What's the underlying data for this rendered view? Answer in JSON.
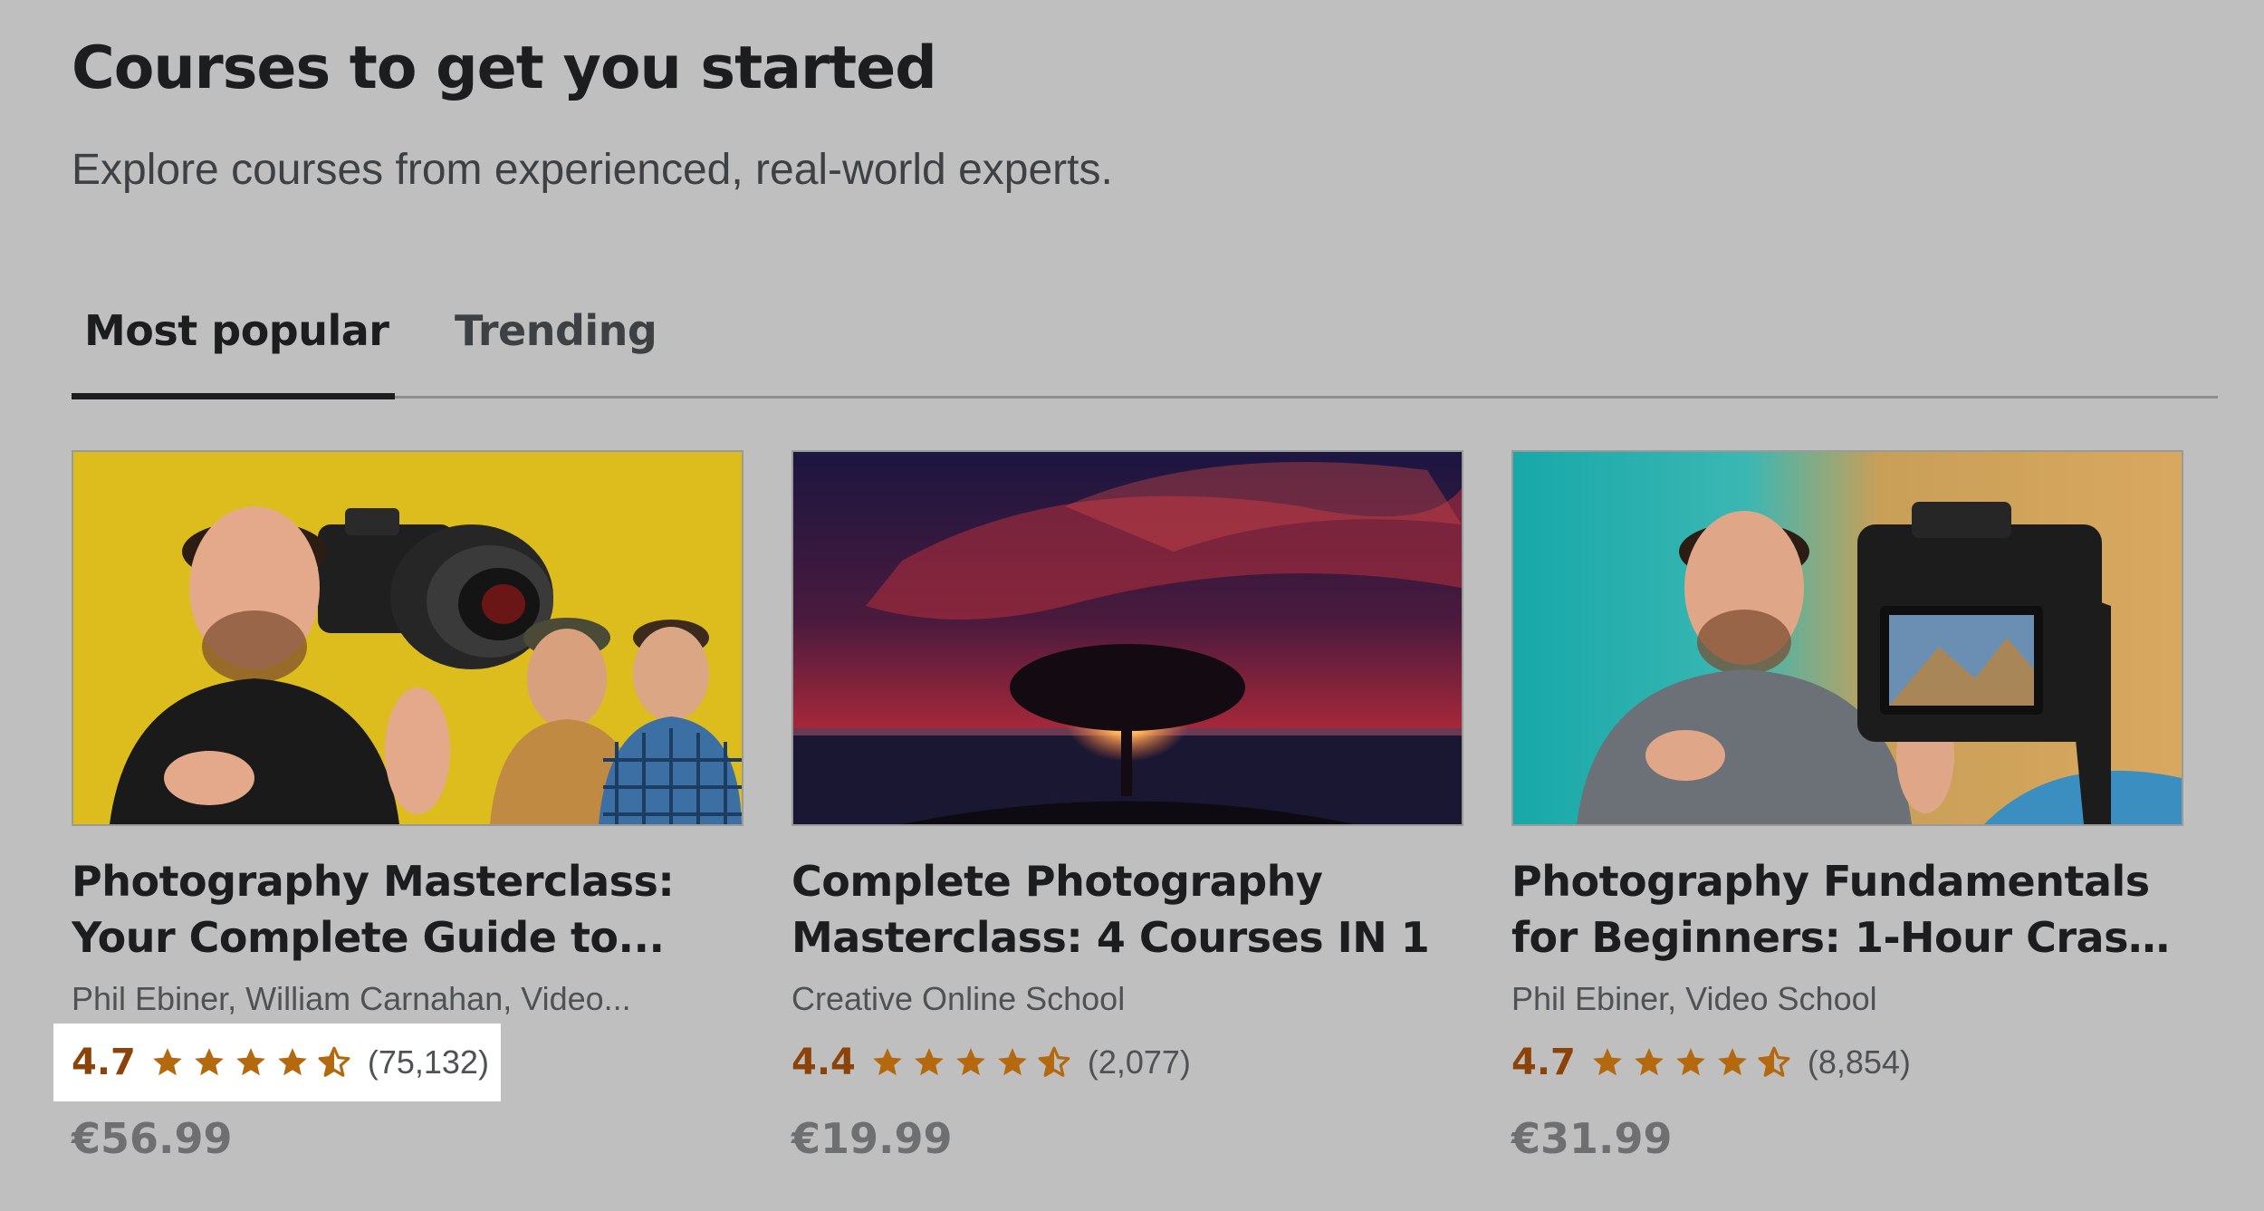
{
  "header": {
    "title": "Courses to get you started",
    "subtitle": "Explore courses from experienced, real-world experts."
  },
  "tabs": [
    {
      "label": "Most popular",
      "active": true
    },
    {
      "label": "Trending",
      "active": false
    }
  ],
  "colors": {
    "rating": "#b4690e",
    "highlight": "#ffffff",
    "background": "#bfbfbf"
  },
  "courses": [
    {
      "title_line1": "Photography Masterclass:",
      "title_line2": "Your Complete Guide to...",
      "instructors": "Phil Ebiner, William Carnahan, Video...",
      "rating": "4.7",
      "rating_value": 4.7,
      "reviews": "(75,132)",
      "price": "€56.99",
      "highlighted": true,
      "thumbnail": "photographers-with-camera-yellow"
    },
    {
      "title_line1": "Complete Photography",
      "title_line2": "Masterclass: 4 Courses IN 1",
      "instructors": "Creative Online School",
      "rating": "4.4",
      "rating_value": 4.4,
      "reviews": "(2,077)",
      "price": "€19.99",
      "highlighted": false,
      "thumbnail": "tree-sunset-red-sky"
    },
    {
      "title_line1": "Photography Fundamentals",
      "title_line2": "for Beginners: 1-Hour Crash...",
      "instructors": "Phil Ebiner, Video School",
      "rating": "4.7",
      "rating_value": 4.7,
      "reviews": "(8,854)",
      "price": "€31.99",
      "highlighted": false,
      "thumbnail": "man-with-camera-teal-desert"
    }
  ]
}
